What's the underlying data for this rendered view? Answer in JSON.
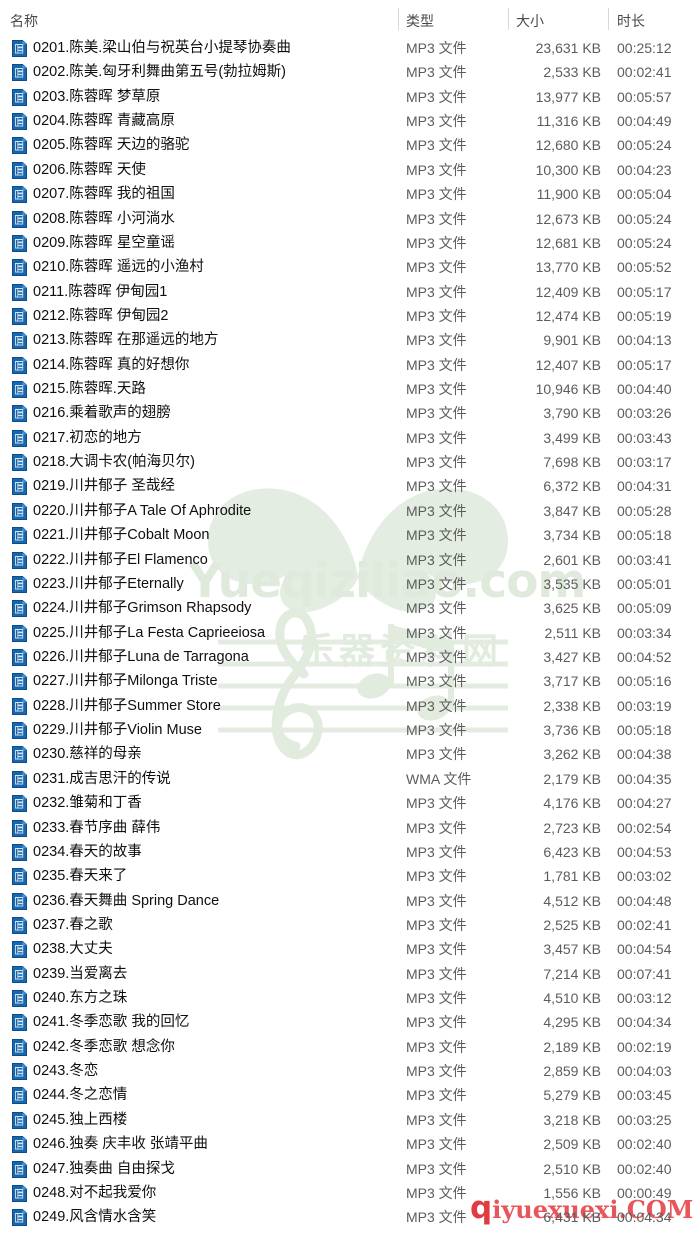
{
  "window": {
    "title": "名称",
    "watermarks": {
      "center_latin": "Yueqiziliao.com",
      "center_cjk": "乐器资料网",
      "corner_prefix": "q",
      "corner_text": "iyuexuexi.COM"
    },
    "colors": {
      "header_text": "#4a4a4a",
      "name_text": "#0f0f0f",
      "meta_text": "#5c5c5c",
      "separator": "#d8d8d8",
      "icon_blue": "#1f6fb5",
      "watermark_green": "#dfeadc",
      "watermark_red": "#e8555a"
    }
  },
  "columns": [
    {
      "key": "name",
      "label": "名称"
    },
    {
      "key": "type",
      "label": "类型"
    },
    {
      "key": "size",
      "label": "大小"
    },
    {
      "key": "duration",
      "label": "时长"
    }
  ],
  "rows": [
    {
      "icon": "mp3-file-icon",
      "name": "0201.陈美.梁山伯与祝英台小提琴协奏曲",
      "type": "MP3 文件",
      "size": "23,631 KB",
      "duration": "00:25:12"
    },
    {
      "icon": "mp3-file-icon",
      "name": "0202.陈美.匈牙利舞曲第五号(勃拉姆斯)",
      "type": "MP3 文件",
      "size": "2,533 KB",
      "duration": "00:02:41"
    },
    {
      "icon": "mp3-file-icon",
      "name": "0203.陈蓉晖 梦草原",
      "type": "MP3 文件",
      "size": "13,977 KB",
      "duration": "00:05:57"
    },
    {
      "icon": "mp3-file-icon",
      "name": "0204.陈蓉晖 青藏高原",
      "type": "MP3 文件",
      "size": "11,316 KB",
      "duration": "00:04:49"
    },
    {
      "icon": "mp3-file-icon",
      "name": "0205.陈蓉晖 天边的骆驼",
      "type": "MP3 文件",
      "size": "12,680 KB",
      "duration": "00:05:24"
    },
    {
      "icon": "mp3-file-icon",
      "name": "0206.陈蓉晖 天使",
      "type": "MP3 文件",
      "size": "10,300 KB",
      "duration": "00:04:23"
    },
    {
      "icon": "mp3-file-icon",
      "name": "0207.陈蓉晖 我的祖国",
      "type": "MP3 文件",
      "size": "11,900 KB",
      "duration": "00:05:04"
    },
    {
      "icon": "mp3-file-icon",
      "name": "0208.陈蓉晖 小河淌水",
      "type": "MP3 文件",
      "size": "12,673 KB",
      "duration": "00:05:24"
    },
    {
      "icon": "mp3-file-icon",
      "name": "0209.陈蓉晖 星空童谣",
      "type": "MP3 文件",
      "size": "12,681 KB",
      "duration": "00:05:24"
    },
    {
      "icon": "mp3-file-icon",
      "name": "0210.陈蓉晖 遥远的小渔村",
      "type": "MP3 文件",
      "size": "13,770 KB",
      "duration": "00:05:52"
    },
    {
      "icon": "mp3-file-icon",
      "name": "0211.陈蓉晖 伊甸园1",
      "type": "MP3 文件",
      "size": "12,409 KB",
      "duration": "00:05:17"
    },
    {
      "icon": "mp3-file-icon",
      "name": "0212.陈蓉晖 伊甸园2",
      "type": "MP3 文件",
      "size": "12,474 KB",
      "duration": "00:05:19"
    },
    {
      "icon": "mp3-file-icon",
      "name": "0213.陈蓉晖 在那遥远的地方",
      "type": "MP3 文件",
      "size": "9,901 KB",
      "duration": "00:04:13"
    },
    {
      "icon": "mp3-file-icon",
      "name": "0214.陈蓉晖 真的好想你",
      "type": "MP3 文件",
      "size": "12,407 KB",
      "duration": "00:05:17"
    },
    {
      "icon": "mp3-file-icon",
      "name": "0215.陈蓉晖.天路",
      "type": "MP3 文件",
      "size": "10,946 KB",
      "duration": "00:04:40"
    },
    {
      "icon": "mp3-file-icon",
      "name": "0216.乘着歌声的翅膀",
      "type": "MP3 文件",
      "size": "3,790 KB",
      "duration": "00:03:26"
    },
    {
      "icon": "mp3-file-icon",
      "name": "0217.初恋的地方",
      "type": "MP3 文件",
      "size": "3,499 KB",
      "duration": "00:03:43"
    },
    {
      "icon": "mp3-file-icon",
      "name": "0218.大调卡农(帕海贝尔)",
      "type": "MP3 文件",
      "size": "7,698 KB",
      "duration": "00:03:17"
    },
    {
      "icon": "mp3-file-icon",
      "name": "0219.川井郁子 圣哉经",
      "type": "MP3 文件",
      "size": "6,372 KB",
      "duration": "00:04:31"
    },
    {
      "icon": "mp3-file-icon",
      "name": "0220.川井郁子A Tale Of Aphrodite",
      "type": "MP3 文件",
      "size": "3,847 KB",
      "duration": "00:05:28"
    },
    {
      "icon": "mp3-file-icon",
      "name": "0221.川井郁子Cobalt Moon",
      "type": "MP3 文件",
      "size": "3,734 KB",
      "duration": "00:05:18"
    },
    {
      "icon": "mp3-file-icon",
      "name": "0222.川井郁子El Flamenco",
      "type": "MP3 文件",
      "size": "2,601 KB",
      "duration": "00:03:41"
    },
    {
      "icon": "mp3-file-icon",
      "name": "0223.川井郁子Eternally",
      "type": "MP3 文件",
      "size": "3,535 KB",
      "duration": "00:05:01"
    },
    {
      "icon": "mp3-file-icon",
      "name": "0224.川井郁子Grimson Rhapsody",
      "type": "MP3 文件",
      "size": "3,625 KB",
      "duration": "00:05:09"
    },
    {
      "icon": "mp3-file-icon",
      "name": "0225.川井郁子La Festa Caprieeiosa",
      "type": "MP3 文件",
      "size": "2,511 KB",
      "duration": "00:03:34"
    },
    {
      "icon": "mp3-file-icon",
      "name": "0226.川井郁子Luna de Tarragona",
      "type": "MP3 文件",
      "size": "3,427 KB",
      "duration": "00:04:52"
    },
    {
      "icon": "mp3-file-icon",
      "name": "0227.川井郁子Milonga Triste",
      "type": "MP3 文件",
      "size": "3,717 KB",
      "duration": "00:05:16"
    },
    {
      "icon": "mp3-file-icon",
      "name": "0228.川井郁子Summer Store",
      "type": "MP3 文件",
      "size": "2,338 KB",
      "duration": "00:03:19"
    },
    {
      "icon": "mp3-file-icon",
      "name": "0229.川井郁子Violin Muse",
      "type": "MP3 文件",
      "size": "3,736 KB",
      "duration": "00:05:18"
    },
    {
      "icon": "mp3-file-icon",
      "name": "0230.慈祥的母亲",
      "type": "MP3 文件",
      "size": "3,262 KB",
      "duration": "00:04:38"
    },
    {
      "icon": "wma-file-icon",
      "name": "0231.成吉思汗的传说",
      "type": "WMA 文件",
      "size": "2,179 KB",
      "duration": "00:04:35"
    },
    {
      "icon": "mp3-file-icon",
      "name": "0232.雏菊和丁香",
      "type": "MP3 文件",
      "size": "4,176 KB",
      "duration": "00:04:27"
    },
    {
      "icon": "mp3-file-icon",
      "name": "0233.春节序曲 薛伟",
      "type": "MP3 文件",
      "size": "2,723 KB",
      "duration": "00:02:54"
    },
    {
      "icon": "mp3-file-icon",
      "name": "0234.春天的故事",
      "type": "MP3 文件",
      "size": "6,423 KB",
      "duration": "00:04:53"
    },
    {
      "icon": "mp3-file-icon",
      "name": "0235.春天来了",
      "type": "MP3 文件",
      "size": "1,781 KB",
      "duration": "00:03:02"
    },
    {
      "icon": "mp3-file-icon",
      "name": "0236.春天舞曲 Spring Dance",
      "type": "MP3 文件",
      "size": "4,512 KB",
      "duration": "00:04:48"
    },
    {
      "icon": "mp3-file-icon",
      "name": "0237.春之歌",
      "type": "MP3 文件",
      "size": "2,525 KB",
      "duration": "00:02:41"
    },
    {
      "icon": "mp3-file-icon",
      "name": "0238.大丈夫",
      "type": "MP3 文件",
      "size": "3,457 KB",
      "duration": "00:04:54"
    },
    {
      "icon": "mp3-file-icon",
      "name": "0239.当爱离去",
      "type": "MP3 文件",
      "size": "7,214 KB",
      "duration": "00:07:41"
    },
    {
      "icon": "mp3-file-icon",
      "name": "0240.东方之珠",
      "type": "MP3 文件",
      "size": "4,510 KB",
      "duration": "00:03:12"
    },
    {
      "icon": "mp3-file-icon",
      "name": "0241.冬季恋歌 我的回忆",
      "type": "MP3 文件",
      "size": "4,295 KB",
      "duration": "00:04:34"
    },
    {
      "icon": "mp3-file-icon",
      "name": "0242.冬季恋歌 想念你",
      "type": "MP3 文件",
      "size": "2,189 KB",
      "duration": "00:02:19"
    },
    {
      "icon": "mp3-file-icon",
      "name": "0243.冬恋",
      "type": "MP3 文件",
      "size": "2,859 KB",
      "duration": "00:04:03"
    },
    {
      "icon": "mp3-file-icon",
      "name": "0244.冬之恋情",
      "type": "MP3 文件",
      "size": "5,279 KB",
      "duration": "00:03:45"
    },
    {
      "icon": "mp3-file-icon",
      "name": "0245.独上西楼",
      "type": "MP3 文件",
      "size": "3,218 KB",
      "duration": "00:03:25"
    },
    {
      "icon": "mp3-file-icon",
      "name": "0246.独奏 庆丰收 张靖平曲",
      "type": "MP3 文件",
      "size": "2,509 KB",
      "duration": "00:02:40"
    },
    {
      "icon": "mp3-file-icon",
      "name": "0247.独奏曲 自由探戈",
      "type": "MP3 文件",
      "size": "2,510 KB",
      "duration": "00:02:40"
    },
    {
      "icon": "mp3-file-icon",
      "name": "0248.对不起我爱你",
      "type": "MP3 文件",
      "size": "1,556 KB",
      "duration": "00:00:49"
    },
    {
      "icon": "mp3-file-icon",
      "name": "0249.风含情水含笑",
      "type": "MP3 文件",
      "size": "6,431 KB",
      "duration": "00:04:34"
    }
  ]
}
